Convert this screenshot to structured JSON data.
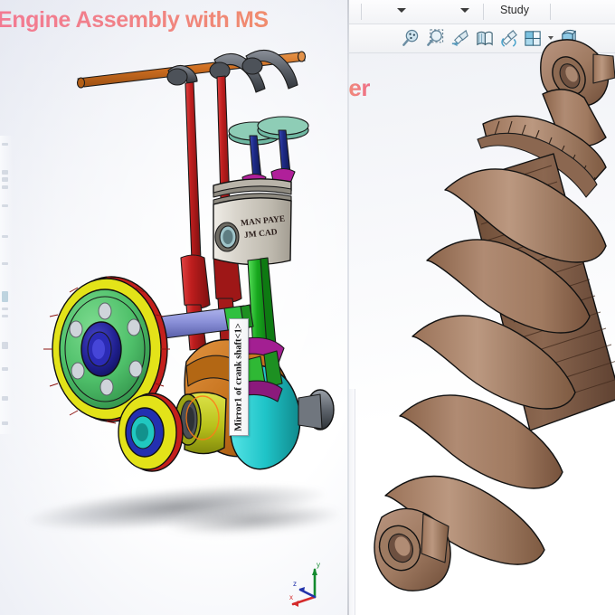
{
  "left_panel": {
    "title": "Engine Assembly with MS",
    "title_gradient": [
      "#f27a93",
      "#f08c6d"
    ],
    "background": "#eef0f6",
    "feature_label": "Mirror1 of crank shaft<1>",
    "piston_engraving": {
      "line1": "MAN PAYE",
      "line2": "JM CAD"
    },
    "triad": {
      "x_label": "x",
      "y_label": "y",
      "z_label": "z",
      "x_color": "#d42b2b",
      "y_color": "#138a2e",
      "z_color": "#2233aa"
    },
    "part_colors": {
      "camshaft": "#d2732a",
      "rocker_arm": "#5a5e66",
      "valve_stem": "#1d2a86",
      "valve_head": "#b0209a",
      "valve_spring": "#5aa08a",
      "pushrod": "#b01c1c",
      "piston": "#cfcac2",
      "connecting_rod": "#18a81e",
      "crank_counterweight": "#c4701b",
      "crank_web": "#1fc4c8",
      "crank_journal": "#c9cf22",
      "gear_face": "#4fc06a",
      "gear_rim": "#e3e319",
      "gear_teeth": "#c4201c",
      "gear_hub": "#1f1f8e",
      "pinion_center": "#20c7c0",
      "shaft": "#8a90d8",
      "shaft_collar": "#2fc040"
    }
  },
  "right_panel": {
    "subtitle": "ber",
    "subtitle_gradient": [
      "#f3b38a",
      "#ef6e86"
    ],
    "menubar": {
      "study_label": "Study",
      "dropdown_icons": [
        "chevron-down-icon",
        "chevron-down-icon"
      ]
    },
    "toolbar": {
      "tools": [
        {
          "name": "zoom-to-fit-icon",
          "label": "Zoom to Fit"
        },
        {
          "name": "zoom-to-area-icon",
          "label": "Zoom to Area"
        },
        {
          "name": "zoom-in-out-icon",
          "label": "Zoom In/Out"
        },
        {
          "name": "section-view-icon",
          "label": "Section View"
        },
        {
          "name": "rotate-view-icon",
          "label": "Rotate View"
        },
        {
          "name": "view-orientation-icon",
          "label": "View Orientation"
        },
        {
          "name": "display-style-icon",
          "label": "Display Style"
        }
      ]
    },
    "model": {
      "name": "shock-absorber",
      "body_color": "#a87e66",
      "spring_color": "#ab8169",
      "outline_color": "#1b1b1b"
    }
  }
}
